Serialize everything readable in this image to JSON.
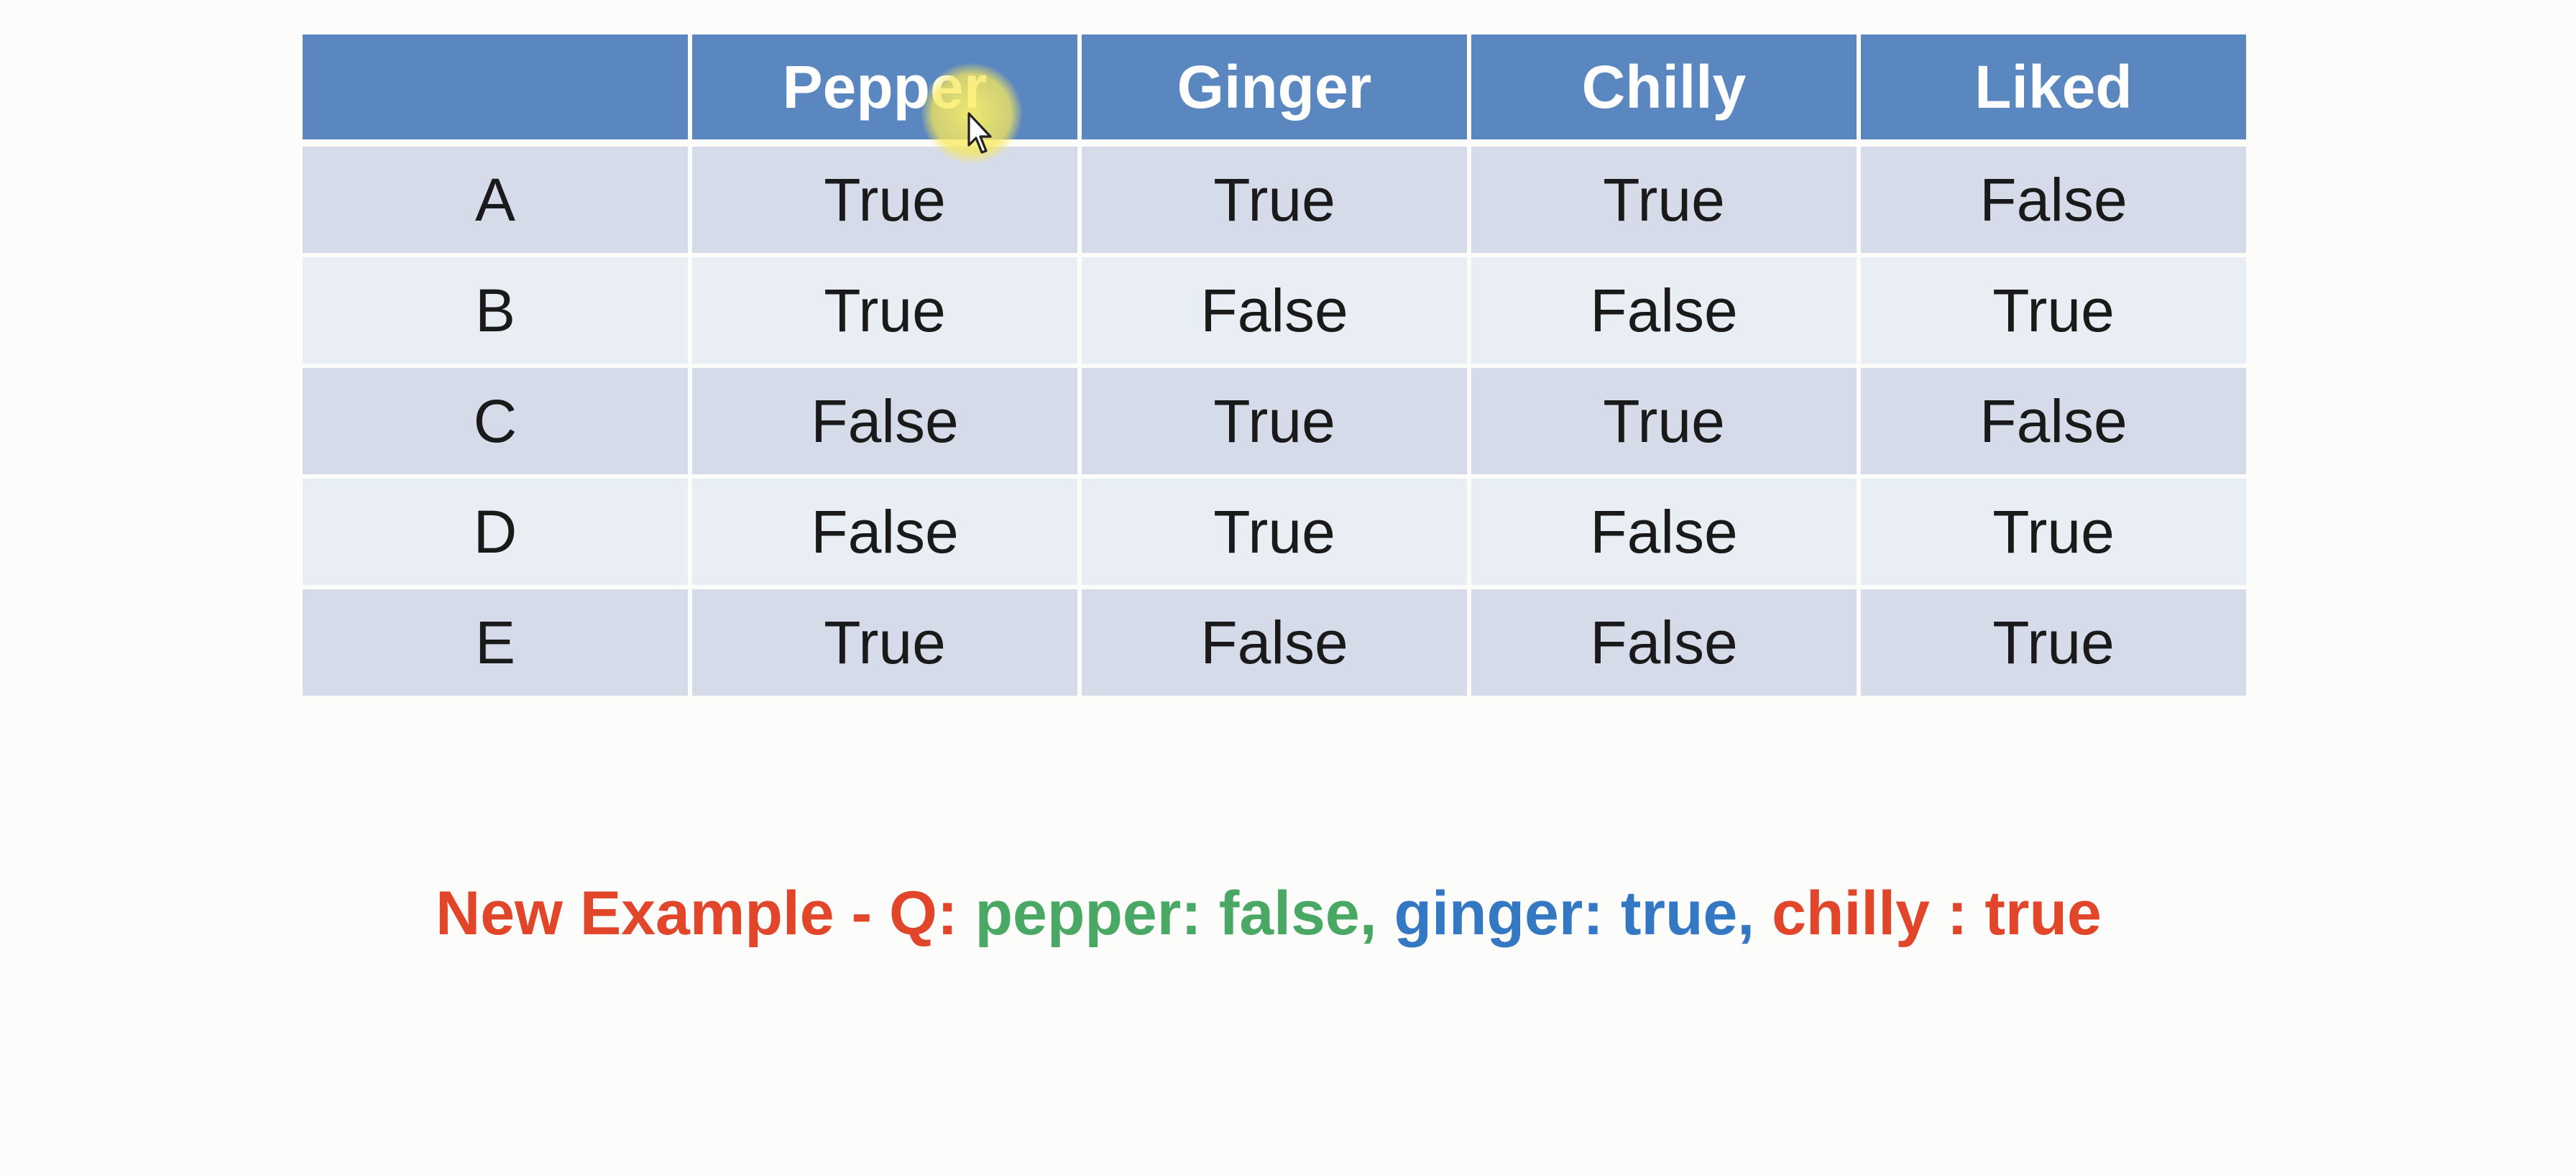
{
  "table": {
    "headers": [
      "",
      "Pepper",
      "Ginger",
      "Chilly",
      "Liked"
    ],
    "rows": [
      [
        "A",
        "True",
        "True",
        "True",
        "False"
      ],
      [
        "B",
        "True",
        "False",
        "False",
        "True"
      ],
      [
        "C",
        "False",
        "True",
        "True",
        "False"
      ],
      [
        "D",
        "False",
        "True",
        "False",
        "True"
      ],
      [
        "E",
        "True",
        "False",
        "False",
        "True"
      ]
    ]
  },
  "query": {
    "prefix": "New Example - Q: ",
    "pepper_part": "pepper: false, ",
    "ginger_part": "ginger: true, ",
    "chilly_part": "chilly : true"
  },
  "colors": {
    "header_bg": "#5b87c0",
    "row_odd": "#d5dbe8",
    "row_even": "#e9edf4",
    "query_red": "#e1462a",
    "query_green": "#4aa865",
    "query_blue": "#3478c4",
    "cursor_highlight": "#f7e85a"
  },
  "icons": {
    "cursor": "mouse-pointer-icon"
  }
}
